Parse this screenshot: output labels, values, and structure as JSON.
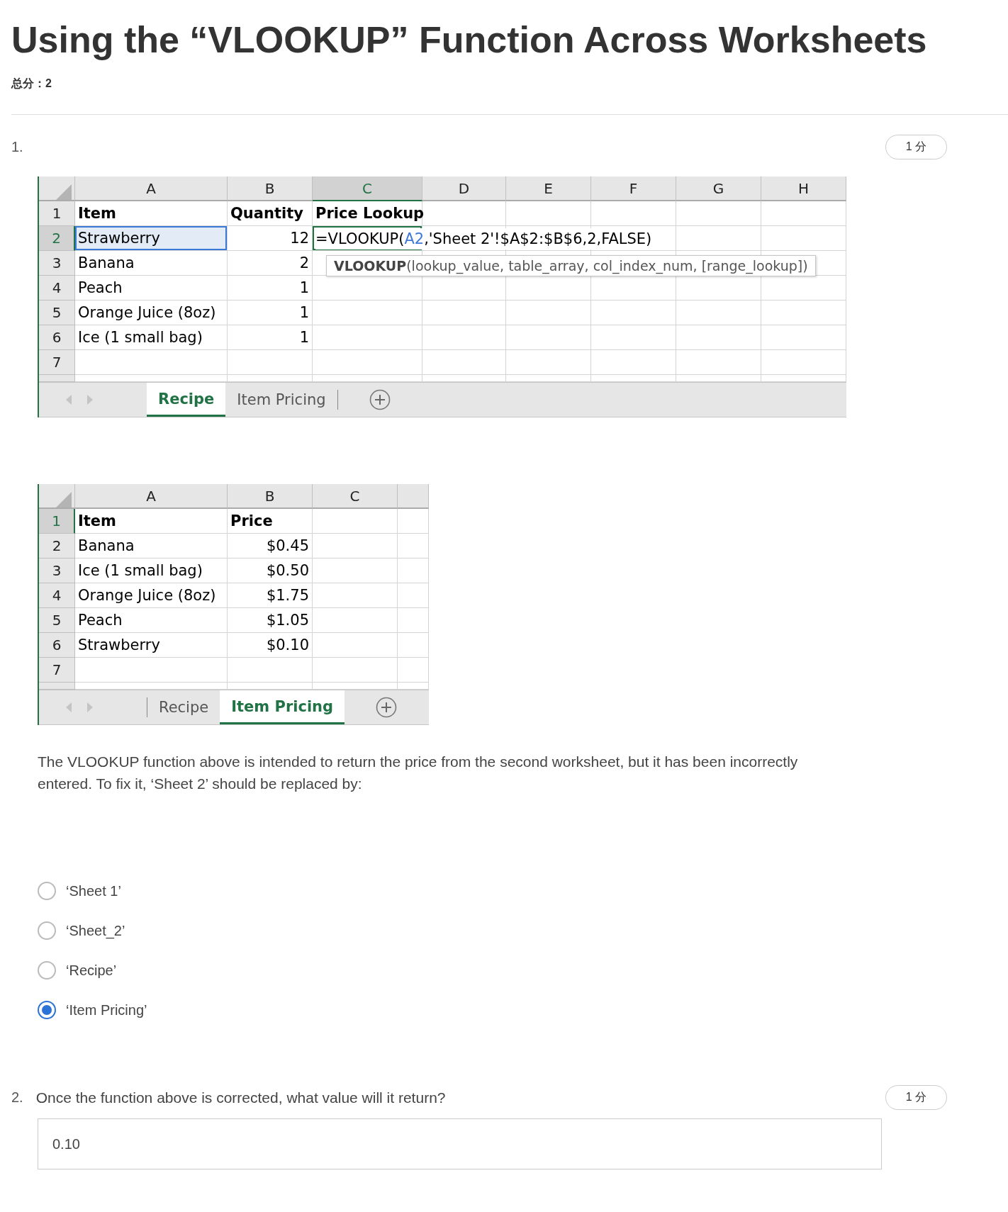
{
  "title": "Using the “VLOOKUP” Function Across Worksheets",
  "total_score": "总分：2",
  "questions": [
    {
      "number": "1.",
      "points": "1 分",
      "spreadsheets": [
        {
          "columns": [
            {
              "label": "A",
              "selected": false
            },
            {
              "label": "B",
              "selected": false
            },
            {
              "label": "C",
              "selected": true
            },
            {
              "label": "D",
              "selected": false
            },
            {
              "label": "E",
              "selected": false
            },
            {
              "label": "F",
              "selected": false
            },
            {
              "label": "G",
              "selected": false
            },
            {
              "label": "H",
              "selected": false
            }
          ],
          "rows": [
            {
              "number": "1",
              "selected": false,
              "cells": [
                {
                  "kind": "heading",
                  "text": "Item"
                },
                {
                  "kind": "heading",
                  "text": "Quantity"
                },
                {
                  "kind": "heading",
                  "text": "Price Lookup"
                }
              ]
            },
            {
              "number": "2",
              "selected": true,
              "cells": [
                {
                  "kind": "text",
                  "text": "Strawberry",
                  "highlighted": true
                },
                {
                  "kind": "number",
                  "text": "12"
                },
                {
                  "kind": "formula",
                  "editing": true,
                  "parts": [
                    {
                      "kind": "plain",
                      "text": "=VLOOKUP("
                    },
                    {
                      "kind": "reference",
                      "text": "A2"
                    },
                    {
                      "kind": "plain",
                      "text": ",'Sheet 2'!$A$2:$B$6,2,FALSE)"
                    }
                  ]
                }
              ]
            },
            {
              "number": "3",
              "selected": false,
              "cells": [
                {
                  "kind": "text",
                  "text": "Banana"
                },
                {
                  "kind": "number",
                  "text": "2"
                }
              ]
            },
            {
              "number": "4",
              "selected": false,
              "cells": [
                {
                  "kind": "text",
                  "text": "Peach"
                },
                {
                  "kind": "number",
                  "text": "1"
                }
              ]
            },
            {
              "number": "5",
              "selected": false,
              "cells": [
                {
                  "kind": "text",
                  "text": "Orange Juice (8oz)"
                },
                {
                  "kind": "number",
                  "text": "1"
                }
              ]
            },
            {
              "number": "6",
              "selected": false,
              "cells": [
                {
                  "kind": "text",
                  "text": "Ice (1 small bag)"
                },
                {
                  "kind": "number",
                  "text": "1"
                }
              ]
            },
            {
              "number": "7",
              "selected": false
            }
          ],
          "tooltip": "**VLOOKUP**(lookup_value, table_array, col_index_num, [range_lookup])",
          "tabs": [
            {
              "label": "Recipe",
              "selected": true
            },
            {
              "label": "Item Pricing",
              "selected": false
            }
          ]
        },
        {
          "columns": [
            {
              "label": "A",
              "selected": false
            },
            {
              "label": "B",
              "selected": false
            },
            {
              "label": "C",
              "selected": false
            }
          ],
          "rows": [
            {
              "number": "1",
              "selected": true,
              "cells": [
                {
                  "kind": "heading",
                  "text": "Item"
                },
                {
                  "kind": "heading",
                  "text": "Price"
                }
              ]
            },
            {
              "number": "2",
              "selected": false,
              "cells": [
                {
                  "kind": "text",
                  "text": "Banana"
                },
                {
                  "kind": "number",
                  "text": "$0.45"
                }
              ]
            },
            {
              "number": "3",
              "selected": false,
              "cells": [
                {
                  "kind": "text",
                  "text": "Ice (1 small bag)"
                },
                {
                  "kind": "number",
                  "text": "$0.50"
                }
              ]
            },
            {
              "number": "4",
              "selected": false,
              "cells": [
                {
                  "kind": "text",
                  "text": "Orange Juice (8oz)"
                },
                {
                  "kind": "number",
                  "text": "$1.75"
                }
              ]
            },
            {
              "number": "5",
              "selected": false,
              "cells": [
                {
                  "kind": "text",
                  "text": "Peach"
                },
                {
                  "kind": "number",
                  "text": "$1.05"
                }
              ]
            },
            {
              "number": "6",
              "selected": false,
              "cells": [
                {
                  "kind": "text",
                  "text": "Strawberry"
                },
                {
                  "kind": "number",
                  "text": "$0.10"
                }
              ]
            },
            {
              "number": "7",
              "selected": false
            }
          ],
          "tabs": [
            {
              "label": "Recipe",
              "selected": false
            },
            {
              "label": "Item Pricing",
              "selected": true
            }
          ]
        }
      ],
      "prompt": "The VLOOKUP function above is intended to return the price from the second worksheet, but it has been incorrectly entered.  To fix it, ‘Sheet 2’ should be replaced by:",
      "options": [
        {
          "label": "‘Sheet 1’",
          "selected": false
        },
        {
          "label": "‘Sheet_2’",
          "selected": false
        },
        {
          "label": "‘Recipe’",
          "selected": false
        },
        {
          "label": "‘Item Pricing’",
          "selected": true
        }
      ]
    },
    {
      "number": "2.",
      "points": "1 分",
      "prompt": "Once the function above is corrected, what value will it return?",
      "answer": "0.10"
    }
  ]
}
